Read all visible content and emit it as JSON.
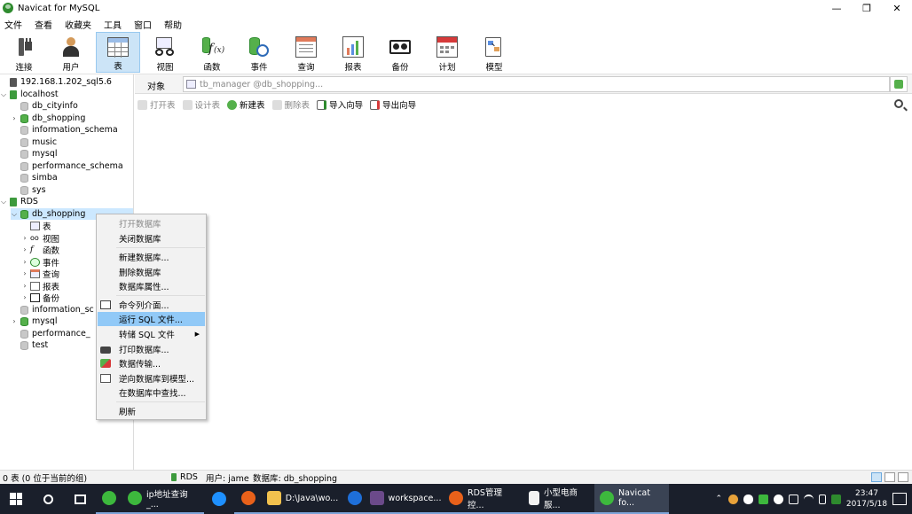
{
  "window": {
    "title": "Navicat for MySQL",
    "minimize": "—",
    "restore": "❐",
    "close": "✕"
  },
  "menu": [
    "文件",
    "查看",
    "收藏夹",
    "工具",
    "窗口",
    "帮助"
  ],
  "toolbar": [
    {
      "label": "连接",
      "icon": "connection-icon"
    },
    {
      "label": "用户",
      "icon": "user-icon"
    },
    {
      "label": "表",
      "icon": "table-icon",
      "active": true
    },
    {
      "label": "视图",
      "icon": "view-icon"
    },
    {
      "label": "函数",
      "icon": "function-icon"
    },
    {
      "label": "事件",
      "icon": "event-icon"
    },
    {
      "label": "查询",
      "icon": "query-icon"
    },
    {
      "label": "报表",
      "icon": "report-icon"
    },
    {
      "label": "备份",
      "icon": "backup-icon"
    },
    {
      "label": "计划",
      "icon": "schedule-icon"
    },
    {
      "label": "模型",
      "icon": "model-icon"
    }
  ],
  "tree": [
    {
      "label": "192.168.1.202_sql5.6",
      "type": "conn"
    },
    {
      "label": "localhost",
      "type": "conn-open"
    },
    {
      "label": "db_cityinfo",
      "type": "db"
    },
    {
      "label": "db_shopping",
      "type": "db-open"
    },
    {
      "label": "information_schema",
      "type": "db"
    },
    {
      "label": "music",
      "type": "db"
    },
    {
      "label": "mysql",
      "type": "db"
    },
    {
      "label": "performance_schema",
      "type": "db"
    },
    {
      "label": "simba",
      "type": "db"
    },
    {
      "label": "sys",
      "type": "db"
    },
    {
      "label": "RDS",
      "type": "conn-open"
    },
    {
      "label": "db_shopping",
      "type": "db-selected"
    },
    {
      "label": "表",
      "type": "obj"
    },
    {
      "label": "视图",
      "type": "obj"
    },
    {
      "label": "函数",
      "type": "obj"
    },
    {
      "label": "事件",
      "type": "obj"
    },
    {
      "label": "查询",
      "type": "obj"
    },
    {
      "label": "报表",
      "type": "obj"
    },
    {
      "label": "备份",
      "type": "obj"
    },
    {
      "label": "information_sc",
      "type": "db"
    },
    {
      "label": "mysql",
      "type": "db-open"
    },
    {
      "label": "performance_",
      "type": "db"
    },
    {
      "label": "test",
      "type": "db"
    }
  ],
  "objects": {
    "tab": "对象",
    "path_placeholder": "tb_manager @db_shopping..."
  },
  "actions": [
    {
      "label": "打开表",
      "disabled": true
    },
    {
      "label": "设计表",
      "disabled": true
    },
    {
      "label": "新建表",
      "disabled": false
    },
    {
      "label": "删除表",
      "disabled": true
    },
    {
      "label": "导入向导",
      "disabled": false
    },
    {
      "label": "导出向导",
      "disabled": false
    }
  ],
  "context_menu": [
    {
      "label": "打开数据库",
      "disabled": true
    },
    {
      "label": "关闭数据库"
    },
    {
      "sep": true
    },
    {
      "label": "新建数据库..."
    },
    {
      "label": "删除数据库"
    },
    {
      "label": "数据库属性..."
    },
    {
      "sep": true
    },
    {
      "label": "命令列介面...",
      "icon": "console-icon"
    },
    {
      "label": "运行 SQL 文件...",
      "highlight": true
    },
    {
      "label": "转储 SQL 文件",
      "submenu": true
    },
    {
      "label": "打印数据库...",
      "icon": "printer-icon"
    },
    {
      "label": "数据传输...",
      "icon": "data-transfer-icon"
    },
    {
      "label": "逆向数据库到模型...",
      "icon": "reverse-model-icon"
    },
    {
      "label": "在数据库中查找..."
    },
    {
      "sep": true
    },
    {
      "label": "刷新"
    }
  ],
  "status": {
    "count": "0 表 (0 位于当前的组)",
    "connection": "RDS",
    "user": "用户: jame",
    "database": "数据库: db_shopping"
  },
  "taskbar": {
    "apps": [
      {
        "label": "",
        "icon": "wechat-icon"
      },
      {
        "label": "ip地址查询_...",
        "icon": "browser-360-icon"
      },
      {
        "label": "",
        "icon": "ie-icon"
      },
      {
        "label": "",
        "icon": "firefox-icon"
      },
      {
        "label": "D:\\Java\\wo...",
        "icon": "folder-icon"
      },
      {
        "label": "",
        "icon": "k-app-icon"
      },
      {
        "label": "workspace...",
        "icon": "eclipse-icon"
      },
      {
        "label": "RDS管理控...",
        "icon": "firefox-icon"
      },
      {
        "label": "小型电商服...",
        "icon": "document-icon"
      },
      {
        "label": "Navicat fo...",
        "icon": "navicat-icon",
        "active": true
      }
    ],
    "time": "23:47",
    "date": "2017/5/18"
  }
}
